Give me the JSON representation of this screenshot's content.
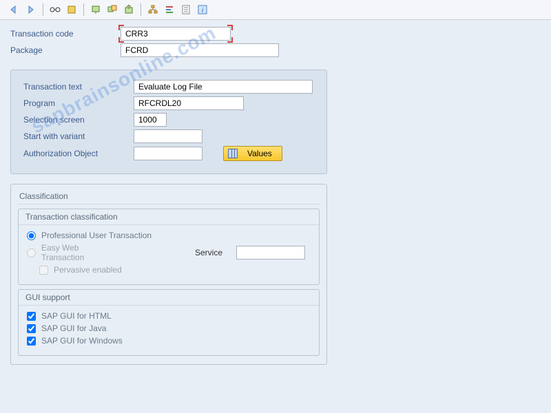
{
  "toolbar": {
    "icons": [
      "back",
      "forward",
      "glasses",
      "execute",
      "open",
      "copy",
      "export",
      "import",
      "hierarchy",
      "align",
      "document",
      "info"
    ]
  },
  "header": {
    "tcode_label": "Transaction code",
    "tcode_value": "CRR3",
    "package_label": "Package",
    "package_value": "FCRD"
  },
  "details": {
    "transaction_text_label": "Transaction text",
    "transaction_text_value": "Evaluate Log File",
    "program_label": "Program",
    "program_value": "RFCRDL20",
    "selection_screen_label": "Selection screen",
    "selection_screen_value": "1000",
    "start_variant_label": "Start with variant",
    "start_variant_value": "",
    "auth_object_label": "Authorization Object",
    "auth_object_value": "",
    "values_button": "Values"
  },
  "classification": {
    "title": "Classification",
    "tc_title": "Transaction classification",
    "radio_professional": "Professional User Transaction",
    "radio_easyweb": "Easy Web Transaction",
    "service_label": "Service",
    "service_value": "",
    "pervasive_label": "Pervasive enabled",
    "gui_title": "GUI support",
    "gui_html": "SAP GUI for HTML",
    "gui_java": "SAP GUI for Java",
    "gui_windows": "SAP GUI for Windows"
  },
  "watermark": "sapbrainsonline.com"
}
